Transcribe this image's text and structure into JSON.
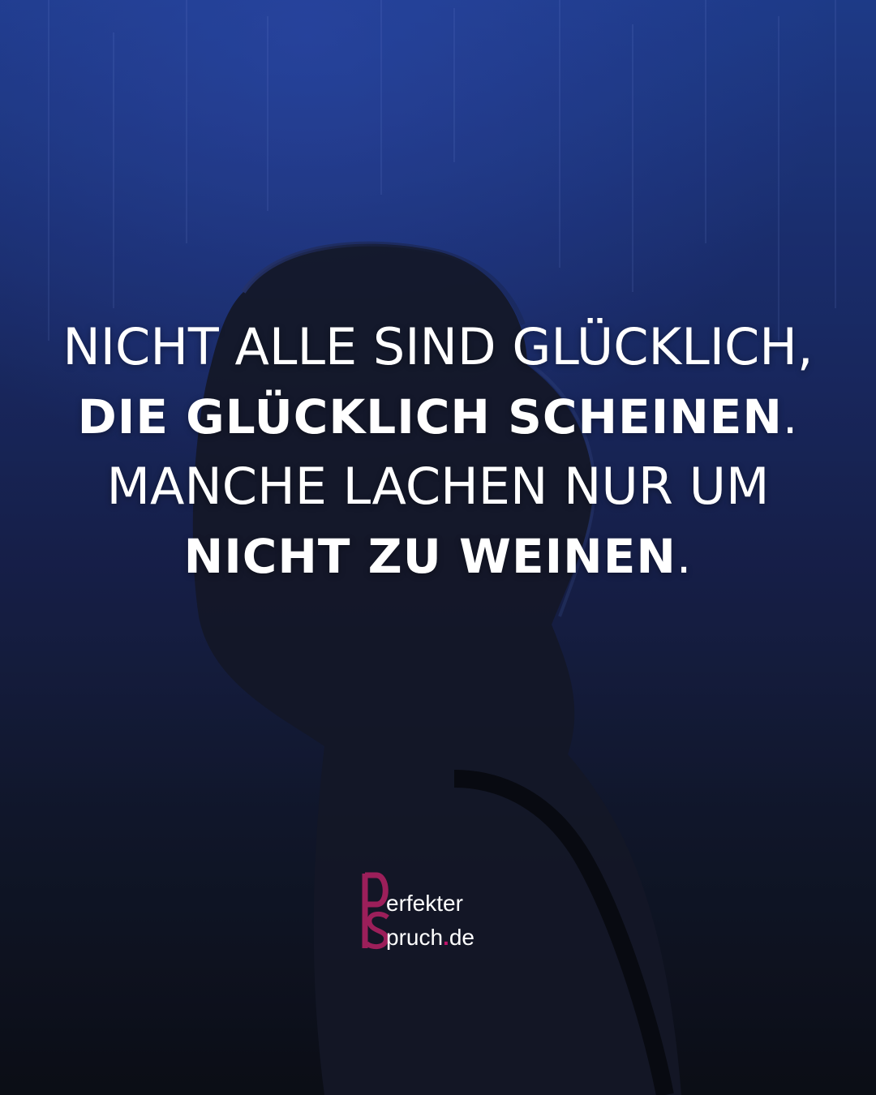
{
  "quote": {
    "line1": "NICHT ALLE SIND GLÜCKLICH,",
    "line2": "DIE GLÜCKLICH SCHEINEN",
    "line2_end": ".",
    "line3": "MANCHE LACHEN NUR UM",
    "line4": "NICHT ZU WEINEN",
    "line4_end": "."
  },
  "logo": {
    "letters": "PS",
    "word1": "erfekter",
    "word2": "pruch",
    "dot": ".",
    "tld": "de",
    "brand_color": "#9c1f5a",
    "accent_color": "#c0146a"
  },
  "colors": {
    "background_top": "#1f3a8c",
    "background_bottom": "#0e111b",
    "text": "#ffffff"
  }
}
